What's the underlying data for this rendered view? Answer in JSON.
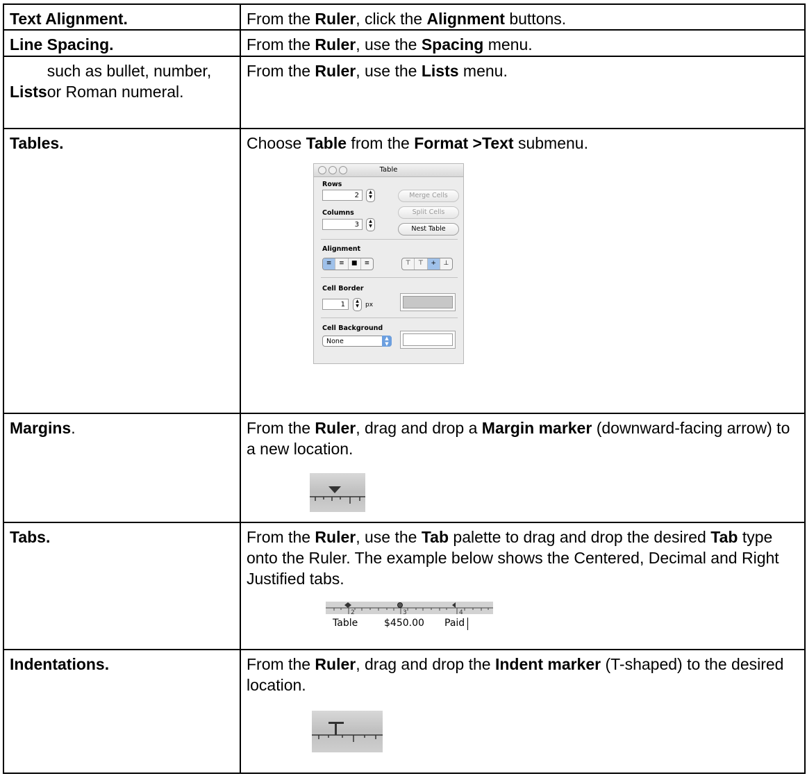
{
  "rows": [
    {
      "label_bold": "Text Alignment.",
      "label_rest": "",
      "desc": [
        {
          "t": "From the "
        },
        {
          "b": "Ruler"
        },
        {
          "t": ", click the "
        },
        {
          "b": "Alignment"
        },
        {
          "t": " buttons."
        }
      ]
    },
    {
      "label_bold": "Line Spacing.",
      "label_rest": "",
      "desc": [
        {
          "t": "From the "
        },
        {
          "b": "Ruler"
        },
        {
          "t": ", use the "
        },
        {
          "b": "Spacing"
        },
        {
          "t": " menu."
        }
      ]
    },
    {
      "label_bold": "Lists",
      "label_rest": " such as bullet, number, or Roman numeral.",
      "desc": [
        {
          "t": "From the "
        },
        {
          "b": "Ruler"
        },
        {
          "t": ", use the "
        },
        {
          "b": "Lists"
        },
        {
          "t": " menu."
        }
      ]
    },
    {
      "label_bold": "Tables.",
      "label_rest": "",
      "desc": [
        {
          "t": "Choose "
        },
        {
          "b": "Table"
        },
        {
          "t": " from the "
        },
        {
          "b": "Format >Text"
        },
        {
          "t": " submenu."
        }
      ]
    },
    {
      "label_bold": "Margins",
      "label_rest": ".",
      "desc": [
        {
          "t": "From the "
        },
        {
          "b": "Ruler"
        },
        {
          "t": ", drag and drop a "
        },
        {
          "b": "Margin marker"
        },
        {
          "t": " (downward-facing arrow) to a new location."
        }
      ]
    },
    {
      "label_bold": "Tabs.",
      "label_rest": "",
      "desc": [
        {
          "t": "From the "
        },
        {
          "b": "Ruler"
        },
        {
          "t": ", use the "
        },
        {
          "b": "Tab"
        },
        {
          "t": " palette to drag and drop the desired "
        },
        {
          "b": "Tab"
        },
        {
          "t": " type onto the Ruler. The example below shows the Centered, Decimal and Right Justified tabs."
        }
      ]
    },
    {
      "label_bold": "Indentations.",
      "label_rest": "",
      "desc": [
        {
          "t": "From the "
        },
        {
          "b": "Ruler"
        },
        {
          "t": ", drag and drop the "
        },
        {
          "b": "Indent marker"
        },
        {
          "t": " (T-shaped) to the desired location."
        }
      ]
    }
  ],
  "table_palette": {
    "title": "Table",
    "rows_label": "Rows",
    "rows_value": "2",
    "columns_label": "Columns",
    "columns_value": "3",
    "merge_cells": "Merge Cells",
    "split_cells": "Split Cells",
    "nest_table": "Nest Table",
    "alignment_label": "Alignment",
    "cell_border_label": "Cell Border",
    "border_value": "1",
    "border_unit": "px",
    "cell_background_label": "Cell Background",
    "background_option": "None"
  },
  "tabs_example": {
    "ruler_numbers": [
      "2",
      "3",
      "4"
    ],
    "item": "Table",
    "amount": "$450.00",
    "status": "Paid"
  }
}
